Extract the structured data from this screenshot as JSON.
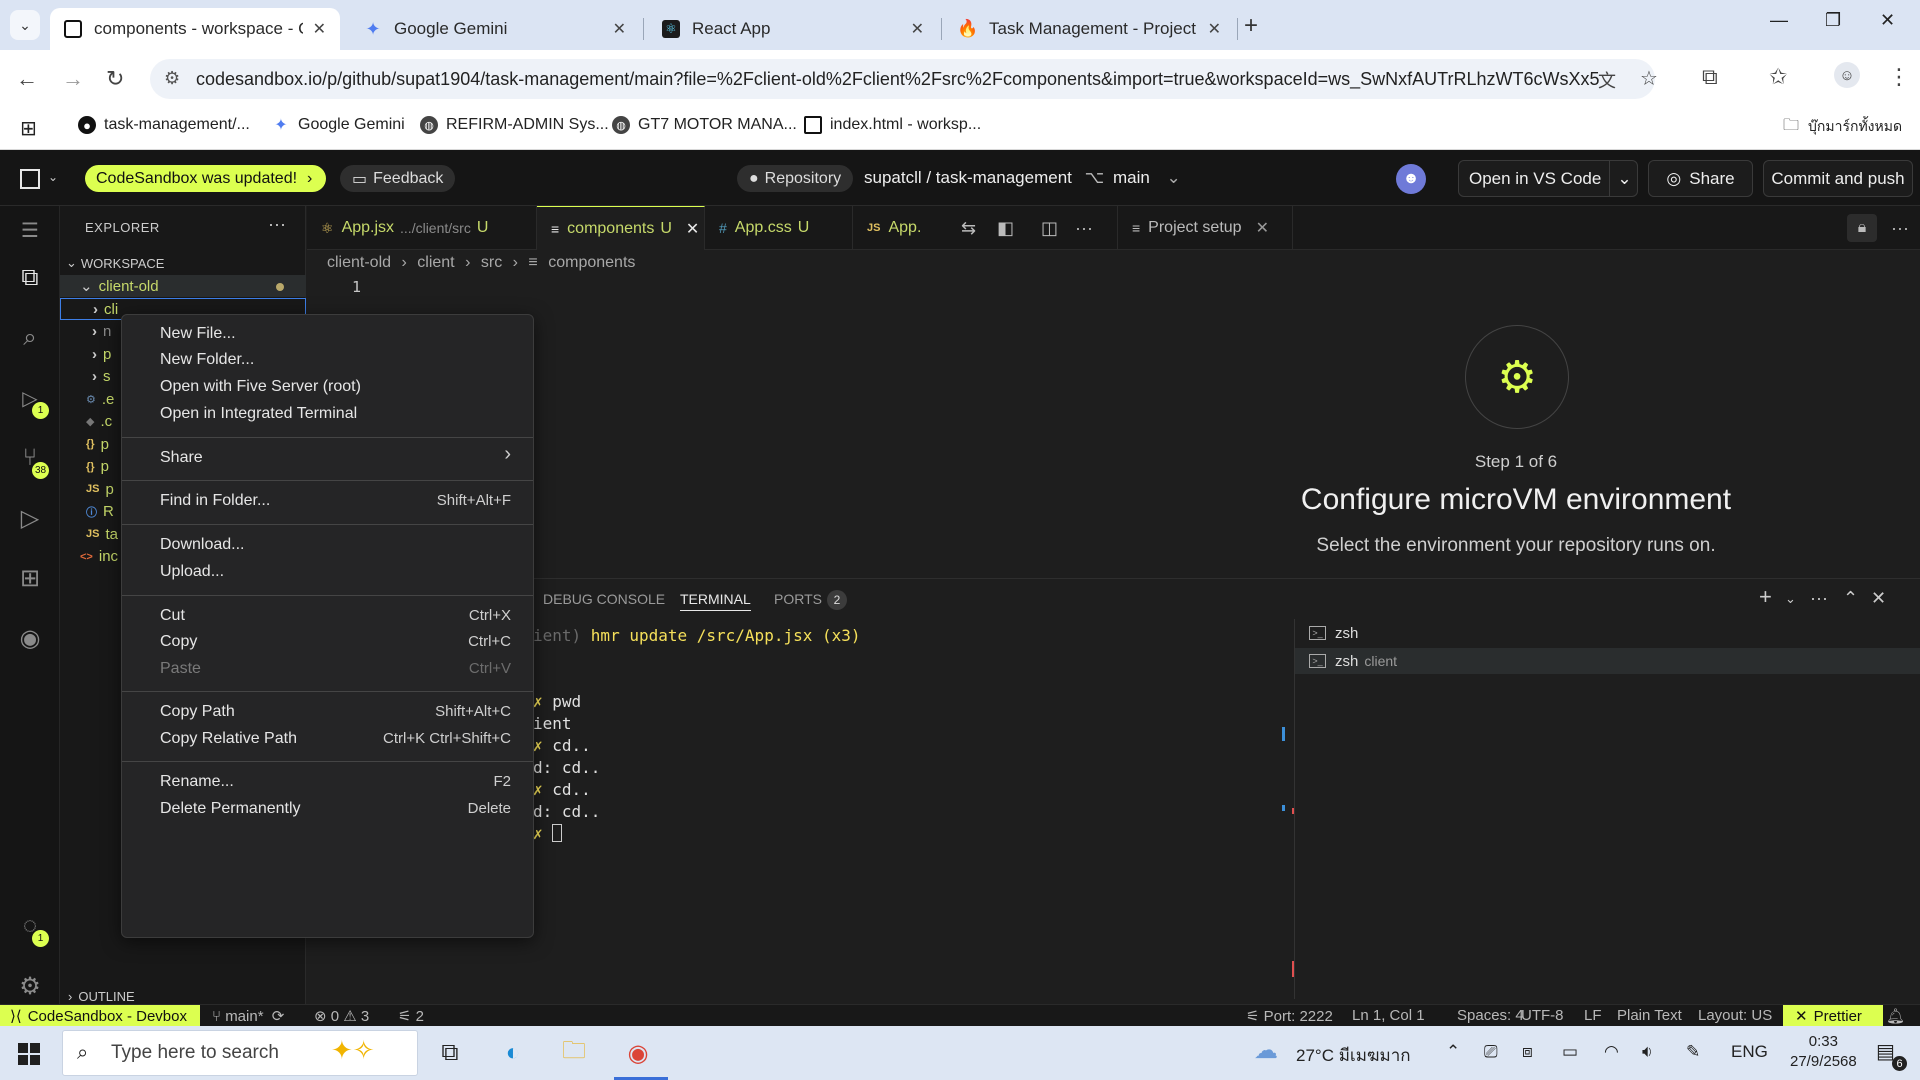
{
  "browser": {
    "tabs": [
      {
        "title": "components - workspace - Cod",
        "active": true
      },
      {
        "title": "Google Gemini",
        "active": false
      },
      {
        "title": "React App",
        "active": false
      },
      {
        "title": "Task Management - Project sett",
        "active": false
      }
    ],
    "url": "codesandbox.io/p/github/supat1904/task-management/main?file=%2Fclient-old%2Fclient%2Fsrc%2Fcomponents&import=true&workspaceId=ws_SwNxfAUTrRLhzWT6cWsXx5",
    "bookmarks": [
      {
        "label": "task-management/..."
      },
      {
        "label": "Google Gemini"
      },
      {
        "label": "REFIRM-ADMIN Sys..."
      },
      {
        "label": "GT7 MOTOR MANA..."
      },
      {
        "label": "index.html - worksp..."
      }
    ],
    "bookmarks_folder": "บุ๊กมาร์กทั้งหมด"
  },
  "csb": {
    "updated_label": "CodeSandbox was updated!",
    "feedback_label": "Feedback",
    "repository_label": "Repository",
    "repo_path": "supatcll / task-management",
    "branch": "main",
    "open_vscode": "Open in VS Code",
    "share": "Share",
    "commit_push": "Commit and push"
  },
  "activity": {
    "terminal_badge": "1",
    "scm_badge": "38",
    "account_badge": "1"
  },
  "explorer": {
    "title": "EXPLORER",
    "workspace": "WORKSPACE",
    "root": "client-old",
    "rows": [
      {
        "label": "cli",
        "color": "#c6d96a"
      },
      {
        "label": "n",
        "color": "#8a8a8a"
      },
      {
        "label": "p",
        "color": "#c6d96a"
      },
      {
        "label": "s",
        "color": "#c6d96a"
      },
      {
        "label": ".e",
        "color": "#c6d96a"
      },
      {
        "label": ".c",
        "color": "#c6d96a"
      },
      {
        "label": "p",
        "color": "#c6d96a"
      },
      {
        "label": "p",
        "color": "#c6d96a"
      },
      {
        "label": "p",
        "color": "#c6d96a"
      },
      {
        "label": "R",
        "color": "#c6d96a"
      },
      {
        "label": "ta",
        "color": "#c6d96a"
      },
      {
        "label": "inc",
        "color": "#c6d96a"
      }
    ],
    "outline": "OUTLINE"
  },
  "editor": {
    "tabs": [
      {
        "label": "App.jsx",
        "path": ".../client/src",
        "status": "U"
      },
      {
        "label": "components",
        "status": "U"
      },
      {
        "label": "App.css",
        "status": "U"
      },
      {
        "label": "App."
      },
      {
        "label": "Project setup"
      }
    ],
    "breadcrumbs": [
      "client-old",
      "client",
      "src",
      "components"
    ],
    "line_number": "1"
  },
  "setup": {
    "step": "Step 1 of 6",
    "title": "Configure microVM environment",
    "subtitle": "Select the environment your repository runs on."
  },
  "panel": {
    "tabs": [
      "DEBUG CONSOLE",
      "TERMINAL",
      "PORTS"
    ],
    "ports_count": "2",
    "terminal_lines": [
      {
        "pre": "ient) ",
        "text": "hmr update /src/App.jsx (x3)"
      },
      {
        "pre": "",
        "text": ""
      },
      {
        "pre": "",
        "text": ""
      },
      {
        "pre": "✗ ",
        "text": "pwd"
      },
      {
        "pre": "",
        "text": "ient"
      },
      {
        "pre": "✗ ",
        "text": "cd.."
      },
      {
        "pre": "",
        "text": "d: cd.."
      },
      {
        "pre": "✗ ",
        "text": "cd.."
      },
      {
        "pre": "",
        "text": "d: cd.."
      },
      {
        "pre": "✗ ",
        "text": ""
      }
    ],
    "terminals": [
      {
        "name": "zsh",
        "sub": ""
      },
      {
        "name": "zsh",
        "sub": "client"
      }
    ]
  },
  "context_menu": {
    "items": [
      {
        "label": "New File...",
        "key": ""
      },
      {
        "label": "New Folder...",
        "key": ""
      },
      {
        "label": "Open with Five Server (root)",
        "key": ""
      },
      {
        "label": "Open in Integrated Terminal",
        "key": ""
      },
      {
        "label": "Share",
        "key": "›"
      },
      {
        "label": "Find in Folder...",
        "key": "Shift+Alt+F"
      },
      {
        "label": "Download...",
        "key": ""
      },
      {
        "label": "Upload...",
        "key": ""
      },
      {
        "label": "Cut",
        "key": "Ctrl+X"
      },
      {
        "label": "Copy",
        "key": "Ctrl+C"
      },
      {
        "label": "Paste",
        "key": "Ctrl+V"
      },
      {
        "label": "Copy Path",
        "key": "Shift+Alt+C"
      },
      {
        "label": "Copy Relative Path",
        "key": "Ctrl+K Ctrl+Shift+C"
      },
      {
        "label": "Rename...",
        "key": "F2"
      },
      {
        "label": "Delete Permanently",
        "key": "Delete"
      }
    ]
  },
  "status": {
    "remote": "CodeSandbox - Devbox",
    "branch": "main*",
    "problems": "⊗ 0 ⚠ 3",
    "ports": "2",
    "port": "Port: 2222",
    "position": "Ln 1, Col 1",
    "spaces": "Spaces: 4",
    "encoding": "UTF-8",
    "eol": "LF",
    "language": "Plain Text",
    "layout": "Layout: US",
    "prettier": "Prettier"
  },
  "taskbar": {
    "search_placeholder": "Type here to search",
    "weather": "27°C มีเมฆมาก",
    "lang": "ENG",
    "time": "0:33",
    "date": "27/9/2568",
    "notif_count": "6"
  }
}
